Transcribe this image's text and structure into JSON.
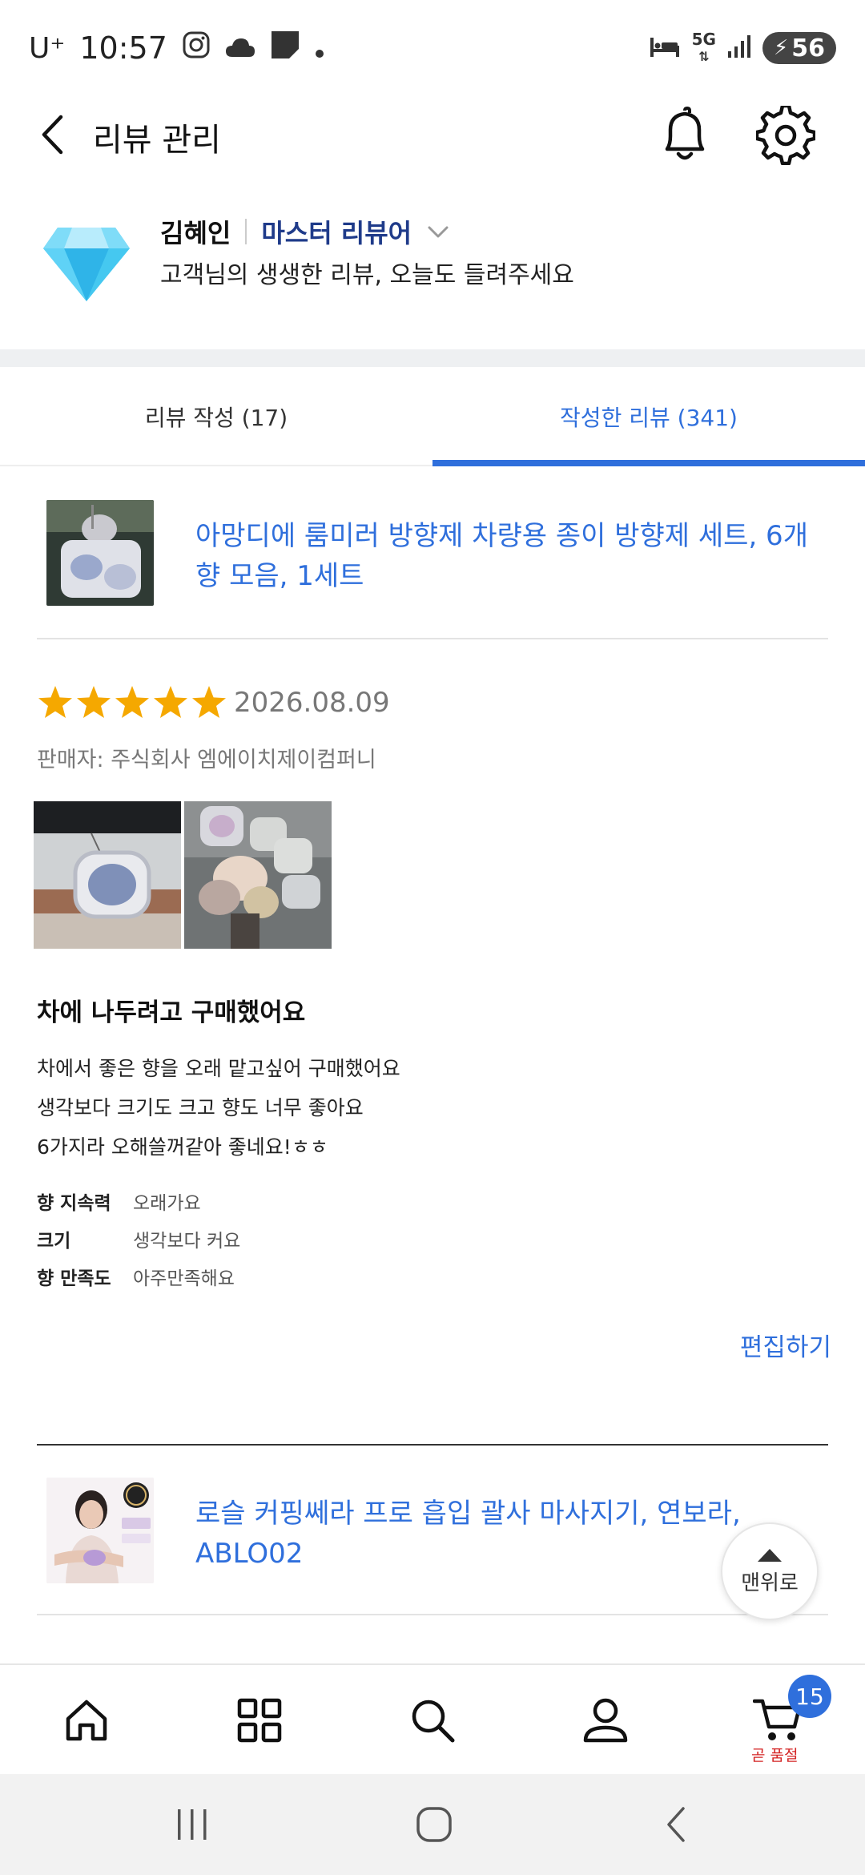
{
  "status_bar": {
    "carrier": "U⁺",
    "time": "10:57",
    "network": "5G",
    "battery": "56"
  },
  "header": {
    "title": "리뷰 관리"
  },
  "profile": {
    "name": "김혜인",
    "grade": "마스터 리뷰어",
    "tagline": "고객님의 생생한 리뷰, 오늘도 들려주세요"
  },
  "tabs": [
    {
      "label": "리뷰 작성 (17)",
      "active": false
    },
    {
      "label": "작성한 리뷰 (341)",
      "active": true
    }
  ],
  "reviews": [
    {
      "product_title": "아망디에 룸미러 방향제 차량용 종이 방향제 세트, 6개 향 모음, 1세트",
      "rating": 5,
      "date": "2026.08.09",
      "seller": "판매자: 주식회사 엠에이치제이컴퍼니",
      "headline": "차에 나두려고 구매했어요",
      "body": [
        "차에서 좋은  향을 오래 맡고싶어 구매했어요",
        "생각보다 크기도 크고 향도 너무 좋아요",
        "6가지라 오해쓸꺼같아 좋네요!ㅎㅎ"
      ],
      "attributes": [
        {
          "label": "향 지속력",
          "value": "오래가요"
        },
        {
          "label": "크기",
          "value": "생각보다 커요"
        },
        {
          "label": "향 만족도",
          "value": "아주만족해요"
        }
      ],
      "edit_label": "편집하기"
    },
    {
      "product_title": "로슬 커핑쎄라 프로 흡입 괄사 마사지기, 연보라, ABLO02"
    }
  ],
  "scroll_top_label": "맨위로",
  "bottom_nav": {
    "cart_badge": "15",
    "cart_status": "곧 품절"
  },
  "colors": {
    "accent": "#2f6fdc",
    "star": "#f5a800",
    "grade": "#1f3b8a",
    "warning": "#d42424"
  }
}
